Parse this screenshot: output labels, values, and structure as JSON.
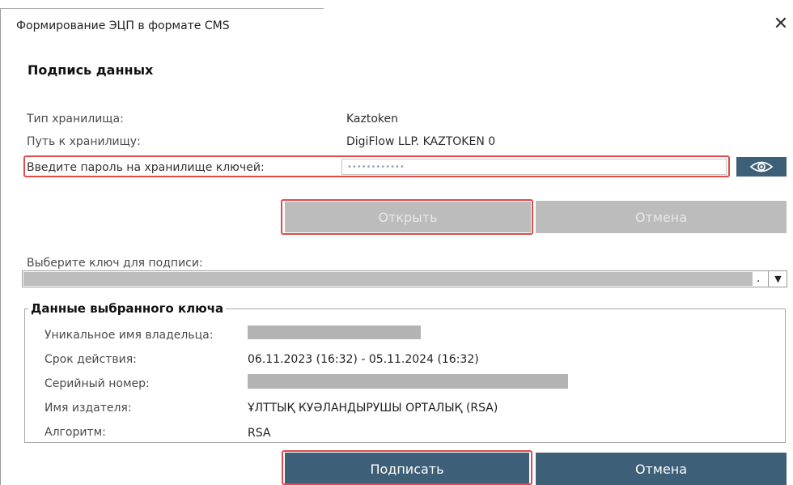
{
  "window": {
    "title": "Формирование ЭЦП в формате CMS",
    "close_glyph": "✕"
  },
  "section": {
    "heading": "Подпись данных"
  },
  "storage": {
    "type_label": "Тип хранилища:",
    "type_value": "Kaztoken",
    "path_label": "Путь к хранилищу:",
    "path_value": "DigiFlow LLP. KAZTOKEN 0",
    "password_label": "Введите пароль на хранилище ключей:",
    "password_value": "••••••••••••",
    "show_password_icon": "eye-icon"
  },
  "buttons": {
    "open": "Открыть",
    "cancel_top": "Отмена",
    "sign": "Подписать",
    "cancel_bottom": "Отмена"
  },
  "key_select": {
    "label": "Выберите ключ для подписи:",
    "dot": ".",
    "arrow": "▼"
  },
  "key_data": {
    "legend": "Данные выбранного ключа",
    "owner_label": "Уникальное имя владельца:",
    "validity_label": "Срок действия:",
    "validity_value": "06.11.2023 (16:32) - 05.11.2024 (16:32)",
    "serial_label": "Серийный номер:",
    "issuer_label": "Имя издателя:",
    "issuer_value": "ҰЛТТЫҚ КУӘЛАНДЫРУШЫ ОРТАЛЫҚ (RSA)",
    "algorithm_label": "Алгоритм:",
    "algorithm_value": "RSA"
  },
  "colors": {
    "primary": "#3d5f78",
    "disabled": "#bcbcbc",
    "highlight": "#e04a4a"
  }
}
